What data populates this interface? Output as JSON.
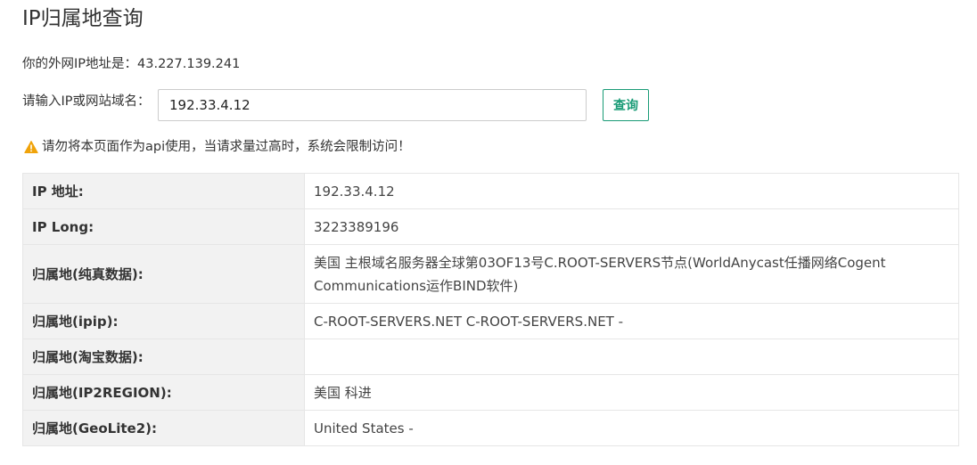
{
  "page": {
    "title": "IP归属地查询"
  },
  "my_ip": {
    "text": "你的外网IP地址是：43.227.139.241"
  },
  "query": {
    "label": "请输入IP或网站域名：",
    "input_value": "192.33.4.12",
    "button_label": "查询"
  },
  "warning": {
    "icon": "warning-icon",
    "text": "请勿将本页面作为api使用，当请求量过高时，系统会限制访问！"
  },
  "results": {
    "rows": [
      {
        "key": "IP 地址:",
        "value": "192.33.4.12"
      },
      {
        "key": "IP Long:",
        "value": "3223389196"
      },
      {
        "key": "归属地(纯真数据):",
        "value": "美国 主根域名服务器全球第03OF13号C.ROOT-SERVERS节点(WorldAnycast任播网络Cogent Communications运作BIND软件)"
      },
      {
        "key": "归属地(ipip):",
        "value": "C-ROOT-SERVERS.NET C-ROOT-SERVERS.NET -"
      },
      {
        "key": "归属地(淘宝数据):",
        "value": ""
      },
      {
        "key": "归属地(IP2REGION):",
        "value": "美国 科进"
      },
      {
        "key": "归属地(GeoLite2):",
        "value": "United States -"
      }
    ]
  },
  "colors": {
    "accent": "#199b76",
    "warning": "#f0a30a",
    "table_key_bg": "#f2f2f2",
    "border": "#e6e6e6"
  }
}
